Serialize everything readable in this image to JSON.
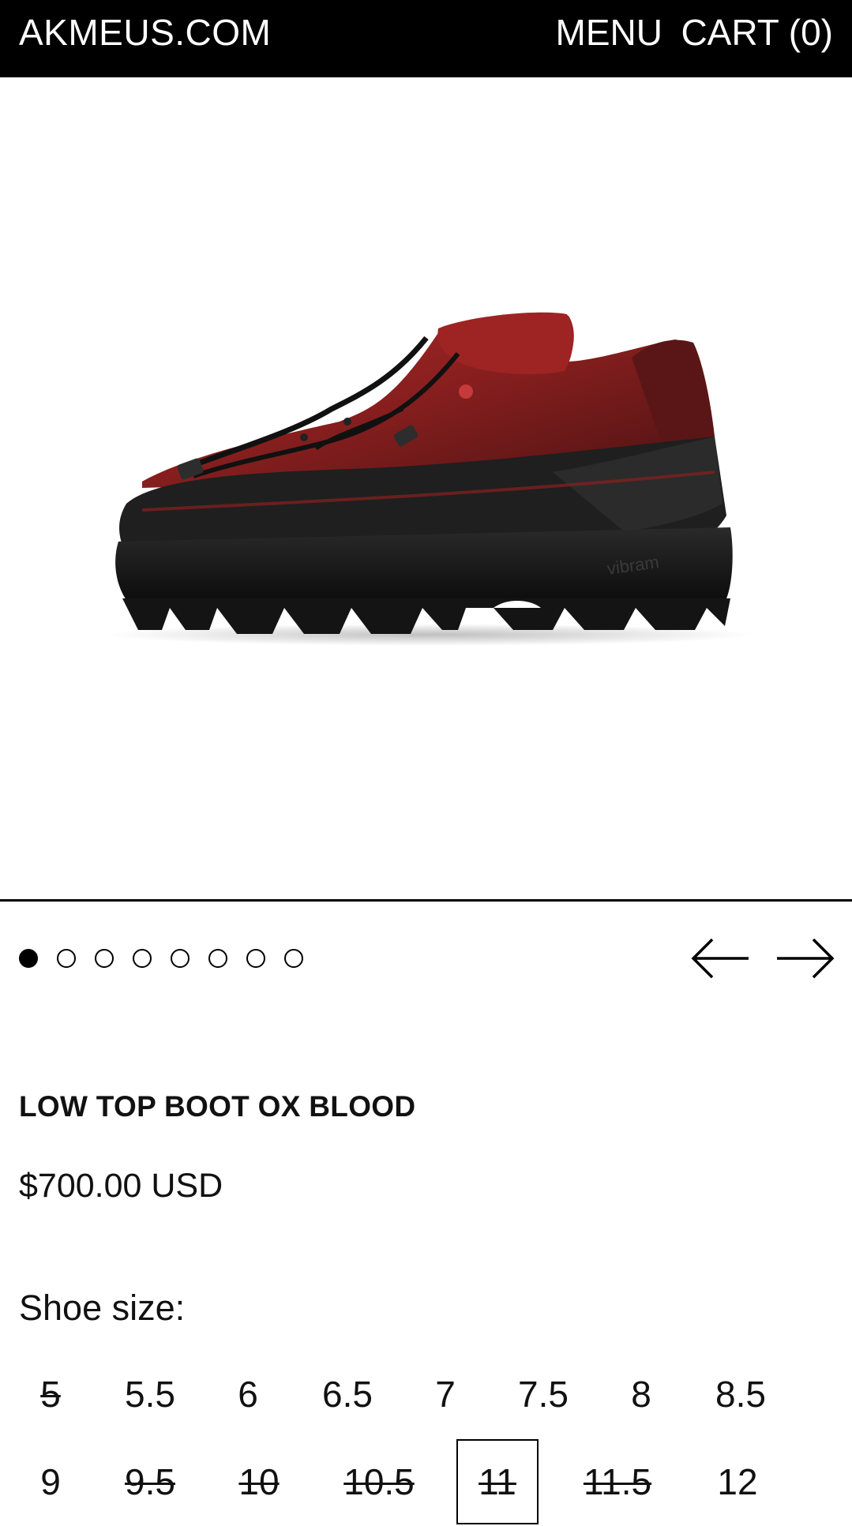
{
  "header": {
    "brand": "AKMEUS.COM",
    "menu_label": "MENU",
    "cart_label": "CART (0)"
  },
  "gallery": {
    "image_alt": "Low top boot in ox blood red leather with black vibram sole",
    "image_count": 8,
    "active_index": 0,
    "prev_icon": "arrow-left-icon",
    "next_icon": "arrow-right-icon"
  },
  "product": {
    "title": "LOW TOP BOOT OX BLOOD",
    "price": "$700.00 USD"
  },
  "sizes": {
    "label": "Shoe size:",
    "selected": "11",
    "options": [
      {
        "label": "5",
        "available": false
      },
      {
        "label": "5.5",
        "available": true
      },
      {
        "label": "6",
        "available": true
      },
      {
        "label": "6.5",
        "available": true
      },
      {
        "label": "7",
        "available": true
      },
      {
        "label": "7.5",
        "available": true
      },
      {
        "label": "8",
        "available": true
      },
      {
        "label": "8.5",
        "available": true
      },
      {
        "label": "9",
        "available": true
      },
      {
        "label": "9.5",
        "available": false
      },
      {
        "label": "10",
        "available": false
      },
      {
        "label": "10.5",
        "available": false
      },
      {
        "label": "11",
        "available": false
      },
      {
        "label": "11.5",
        "available": false
      },
      {
        "label": "12",
        "available": true
      }
    ]
  },
  "colors": {
    "header_bg": "#000000",
    "header_text": "#ffffff",
    "leather": "#8a1f1f",
    "sole": "#1a1a1a"
  }
}
